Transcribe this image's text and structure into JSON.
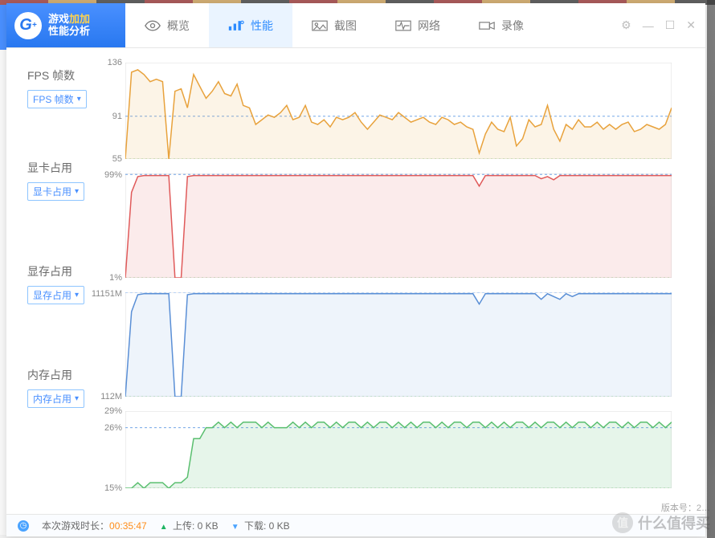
{
  "logo": {
    "line1_a": "游戏",
    "line1_b": "加加",
    "line2": "性能分析"
  },
  "tabs": {
    "overview": "概览",
    "performance": "性能",
    "screenshot": "截图",
    "network": "网络",
    "record": "录像"
  },
  "metrics": {
    "fps": {
      "title": "FPS 帧数",
      "select": "FPS 帧数"
    },
    "gpu": {
      "title": "显卡占用",
      "select": "显卡占用"
    },
    "vram": {
      "title": "显存占用",
      "select": "显存占用"
    },
    "mem": {
      "title": "内存占用",
      "select": "内存占用"
    }
  },
  "status": {
    "session_label": "本次游戏时长：",
    "session_time": "00:35:47",
    "upload_label": "上传:",
    "upload_value": "0 KB",
    "download_label": "下载:",
    "download_value": "0 KB"
  },
  "watermark": "什么值得买",
  "version_hint": "版本号：2…",
  "chart_data": [
    {
      "type": "area",
      "name": "fps",
      "ylim": [
        55,
        136
      ],
      "guide": 91,
      "y_ticks": [
        "136",
        "91",
        "55"
      ],
      "color": "#e8a23c",
      "fill": "rgba(232,162,60,0.12)",
      "values": [
        55,
        128,
        130,
        126,
        120,
        122,
        120,
        55,
        112,
        114,
        98,
        126,
        116,
        106,
        112,
        120,
        110,
        108,
        118,
        100,
        98,
        84,
        88,
        92,
        90,
        94,
        100,
        88,
        90,
        100,
        86,
        84,
        88,
        82,
        90,
        88,
        90,
        94,
        86,
        80,
        86,
        92,
        90,
        88,
        94,
        90,
        86,
        88,
        90,
        86,
        84,
        90,
        88,
        84,
        86,
        82,
        80,
        60,
        76,
        86,
        80,
        78,
        90,
        66,
        72,
        88,
        82,
        84,
        100,
        80,
        70,
        84,
        80,
        88,
        82,
        82,
        86,
        80,
        84,
        80,
        84,
        86,
        78,
        80,
        84,
        82,
        80,
        84,
        98
      ]
    },
    {
      "type": "area",
      "name": "gpu_usage",
      "ylim": [
        1,
        100
      ],
      "guide": 99,
      "y_ticks": [
        "99%",
        "1%"
      ],
      "color": "#e05a5a",
      "fill": "rgba(224,90,90,0.12)",
      "values": [
        1,
        82,
        97,
        98,
        98,
        98,
        98,
        98,
        1,
        1,
        97,
        98,
        98,
        98,
        98,
        98,
        98,
        98,
        98,
        98,
        98,
        98,
        98,
        98,
        98,
        98,
        98,
        98,
        98,
        98,
        98,
        98,
        98,
        98,
        98,
        98,
        98,
        98,
        98,
        98,
        98,
        98,
        98,
        98,
        98,
        98,
        98,
        98,
        98,
        98,
        98,
        98,
        98,
        98,
        98,
        98,
        98,
        88,
        98,
        98,
        98,
        98,
        98,
        98,
        98,
        98,
        98,
        95,
        97,
        94,
        98,
        98,
        98,
        98,
        98,
        98,
        98,
        98,
        98,
        98,
        98,
        98,
        98,
        98,
        98,
        98,
        98,
        98,
        98
      ]
    },
    {
      "type": "area",
      "name": "vram_usage",
      "ylim": [
        112,
        11151
      ],
      "guide": 11151,
      "y_ticks": [
        "11151M",
        "112M"
      ],
      "color": "#5a8fd6",
      "fill": "rgba(90,143,214,0.10)",
      "values": [
        112,
        9100,
        10900,
        11000,
        11000,
        11000,
        11000,
        11000,
        112,
        112,
        10900,
        11000,
        11000,
        11000,
        11000,
        11000,
        11000,
        11000,
        11000,
        11000,
        11000,
        11000,
        11000,
        11000,
        11000,
        11000,
        11000,
        11000,
        11000,
        11000,
        11000,
        11000,
        11000,
        11000,
        11000,
        11000,
        11000,
        11000,
        11000,
        11000,
        11000,
        11000,
        11000,
        11000,
        11000,
        11000,
        11000,
        11000,
        11000,
        11000,
        11000,
        11000,
        11000,
        11000,
        11000,
        11000,
        11000,
        9900,
        11000,
        11000,
        11000,
        11000,
        11000,
        11000,
        11000,
        11000,
        11000,
        10400,
        11000,
        10700,
        10400,
        11000,
        10700,
        11000,
        11000,
        11000,
        11000,
        11000,
        11000,
        11000,
        11000,
        11000,
        11000,
        11000,
        11000,
        11000,
        11000,
        11000,
        11000
      ]
    },
    {
      "type": "area",
      "name": "mem_usage",
      "ylim": [
        15,
        29
      ],
      "guide": 26,
      "y_ticks": [
        "29%",
        "26%",
        "15%"
      ],
      "color": "#5abf6f",
      "fill": "rgba(90,191,111,0.15)",
      "values": [
        15,
        15,
        16,
        15,
        16,
        16,
        16,
        15,
        16,
        16,
        17,
        24,
        24,
        26,
        26,
        27,
        26,
        27,
        26,
        27,
        27,
        27,
        26,
        27,
        26,
        26,
        26,
        27,
        26,
        27,
        26,
        27,
        27,
        26,
        27,
        26,
        27,
        27,
        26,
        27,
        26,
        27,
        27,
        26,
        27,
        26,
        27,
        26,
        27,
        27,
        26,
        27,
        26,
        27,
        27,
        26,
        27,
        27,
        26,
        27,
        26,
        27,
        26,
        27,
        27,
        26,
        27,
        26,
        27,
        27,
        26,
        27,
        26,
        27,
        27,
        26,
        27,
        26,
        27,
        27,
        26,
        27,
        26,
        27,
        27,
        26,
        27,
        26,
        27
      ]
    }
  ]
}
